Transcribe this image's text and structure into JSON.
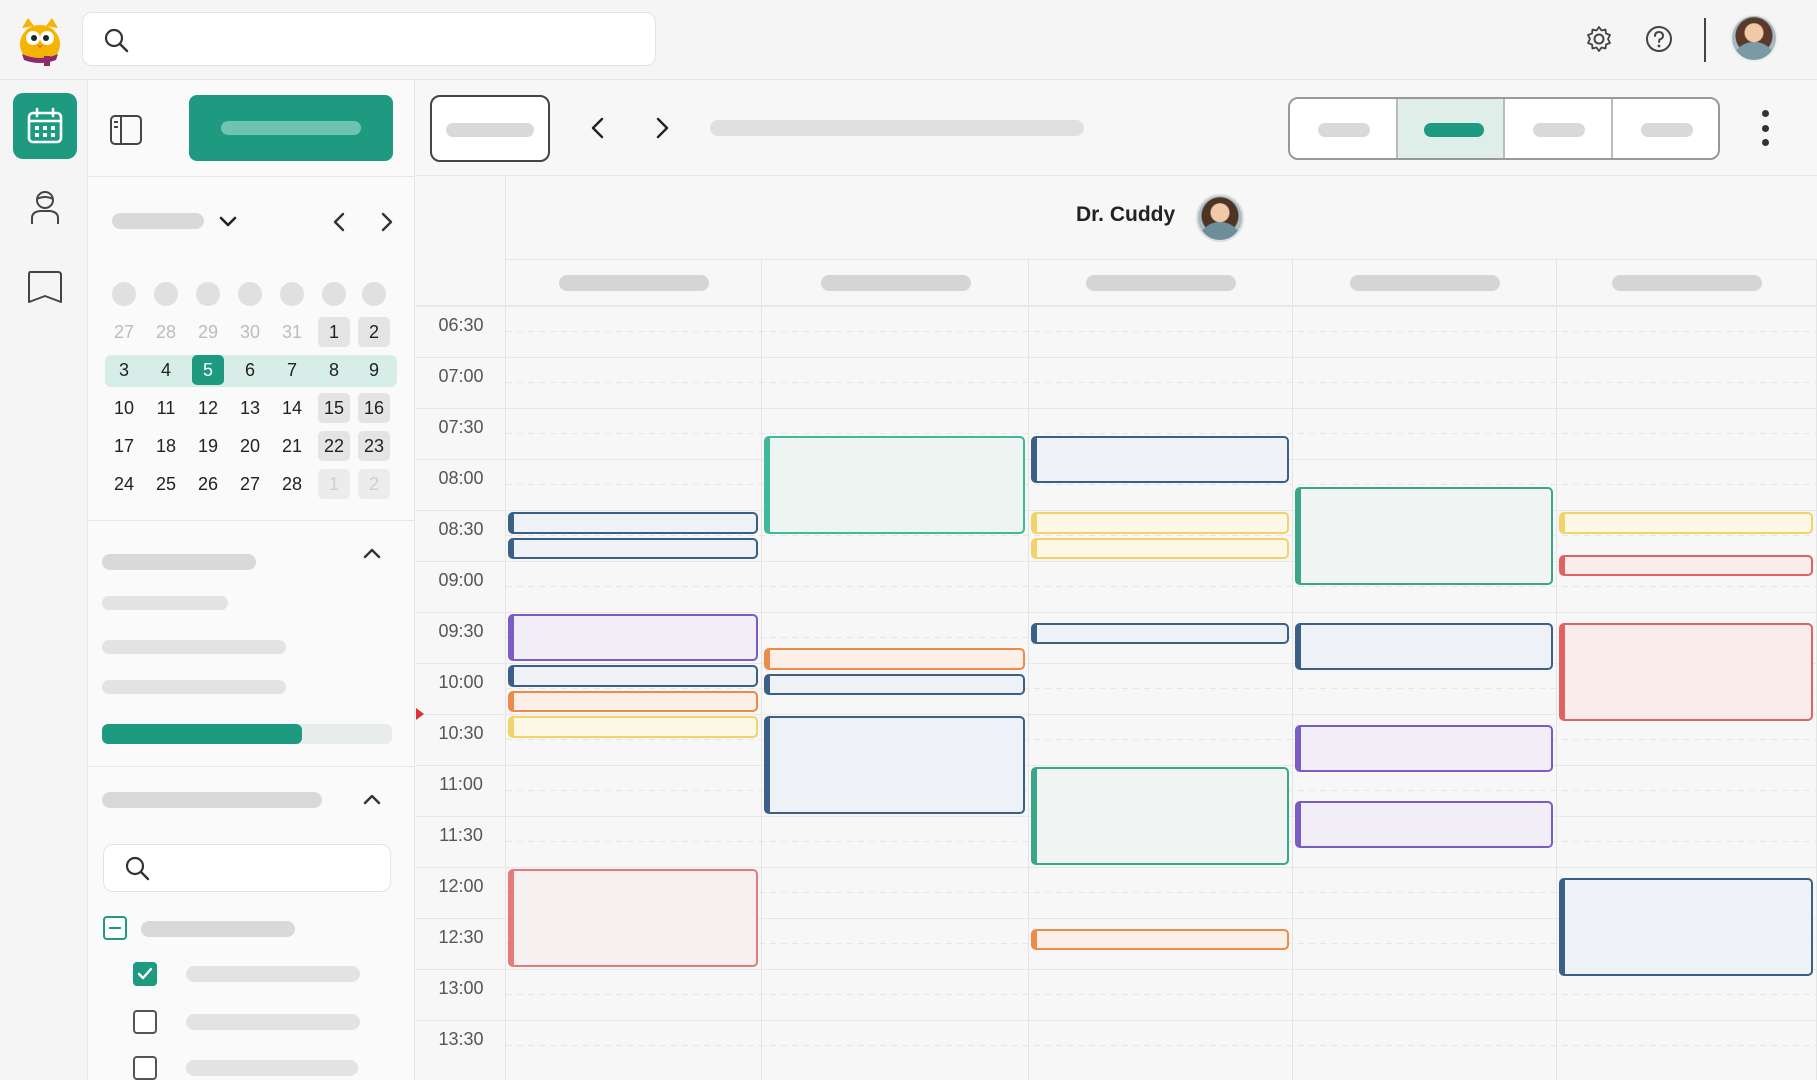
{
  "app": {
    "logo_icon": "owl-mascot-icon",
    "accent_color": "#1d9a80"
  },
  "header": {
    "search": {
      "placeholder": "",
      "icon": "search-icon"
    },
    "settings_icon": "gear-icon",
    "help_icon": "help-circle-icon",
    "avatar": "user-avatar"
  },
  "rail": {
    "items": [
      {
        "name": "calendar",
        "icon": "calendar-icon",
        "active": true
      },
      {
        "name": "staff",
        "icon": "person-icon",
        "active": false
      },
      {
        "name": "book",
        "icon": "book-icon",
        "active": false
      }
    ]
  },
  "mini_calendar": {
    "weekday_count": 7,
    "weeks": [
      [
        "27",
        "28",
        "29",
        "30",
        "31",
        "1",
        "2"
      ],
      [
        "3",
        "4",
        "5",
        "6",
        "7",
        "8",
        "9"
      ],
      [
        "10",
        "11",
        "12",
        "13",
        "14",
        "15",
        "16"
      ],
      [
        "17",
        "18",
        "19",
        "20",
        "21",
        "22",
        "23"
      ],
      [
        "24",
        "25",
        "26",
        "27",
        "28",
        "1",
        "2"
      ]
    ],
    "selected_day": "5",
    "selected_week_index": 1
  },
  "utilization": {
    "progress_fraction": 0.69
  },
  "calendar": {
    "provider": {
      "name": "Dr. Cuddy"
    },
    "times": [
      "06:30",
      "07:00",
      "07:30",
      "08:00",
      "08:30",
      "09:00",
      "09:30",
      "10:00",
      "10:30",
      "11:00",
      "11:30",
      "12:00",
      "12:30",
      "13:00",
      "13:30"
    ],
    "now_time": "10:30",
    "columns": 5,
    "events": [
      {
        "day": 0,
        "start": "08:30",
        "end": "08:45",
        "color": "blue"
      },
      {
        "day": 0,
        "start": "08:45",
        "end": "09:00",
        "color": "blue"
      },
      {
        "day": 0,
        "start": "09:30",
        "end": "10:00",
        "color": "purple"
      },
      {
        "day": 0,
        "start": "10:00",
        "end": "10:15",
        "color": "blue"
      },
      {
        "day": 0,
        "start": "10:15",
        "end": "10:30",
        "color": "orange"
      },
      {
        "day": 0,
        "start": "10:30",
        "end": "10:45",
        "color": "yellow"
      },
      {
        "day": 0,
        "start": "12:00",
        "end": "13:00",
        "color": "red-soft"
      },
      {
        "day": 1,
        "start": "07:45",
        "end": "08:45",
        "color": "green"
      },
      {
        "day": 1,
        "start": "09:50",
        "end": "10:05",
        "color": "orange"
      },
      {
        "day": 1,
        "start": "10:05",
        "end": "10:20",
        "color": "blue"
      },
      {
        "day": 1,
        "start": "10:30",
        "end": "11:30",
        "color": "blue"
      },
      {
        "day": 2,
        "start": "07:45",
        "end": "08:15",
        "color": "blue"
      },
      {
        "day": 2,
        "start": "08:30",
        "end": "08:45",
        "color": "yellow"
      },
      {
        "day": 2,
        "start": "08:45",
        "end": "09:00",
        "color": "yellow"
      },
      {
        "day": 2,
        "start": "09:35",
        "end": "09:50",
        "color": "blue"
      },
      {
        "day": 2,
        "start": "11:00",
        "end": "12:00",
        "color": "teal"
      },
      {
        "day": 2,
        "start": "12:35",
        "end": "12:50",
        "color": "orange"
      },
      {
        "day": 3,
        "start": "08:15",
        "end": "09:15",
        "color": "teal"
      },
      {
        "day": 3,
        "start": "09:35",
        "end": "10:05",
        "color": "blue"
      },
      {
        "day": 3,
        "start": "10:35",
        "end": "11:05",
        "color": "purple"
      },
      {
        "day": 3,
        "start": "11:20",
        "end": "11:50",
        "color": "purple"
      },
      {
        "day": 4,
        "start": "08:30",
        "end": "08:45",
        "color": "yellow"
      },
      {
        "day": 4,
        "start": "08:55",
        "end": "09:10",
        "color": "red"
      },
      {
        "day": 4,
        "start": "09:35",
        "end": "10:35",
        "color": "red"
      },
      {
        "day": 4,
        "start": "12:05",
        "end": "13:05",
        "color": "blue"
      }
    ]
  }
}
